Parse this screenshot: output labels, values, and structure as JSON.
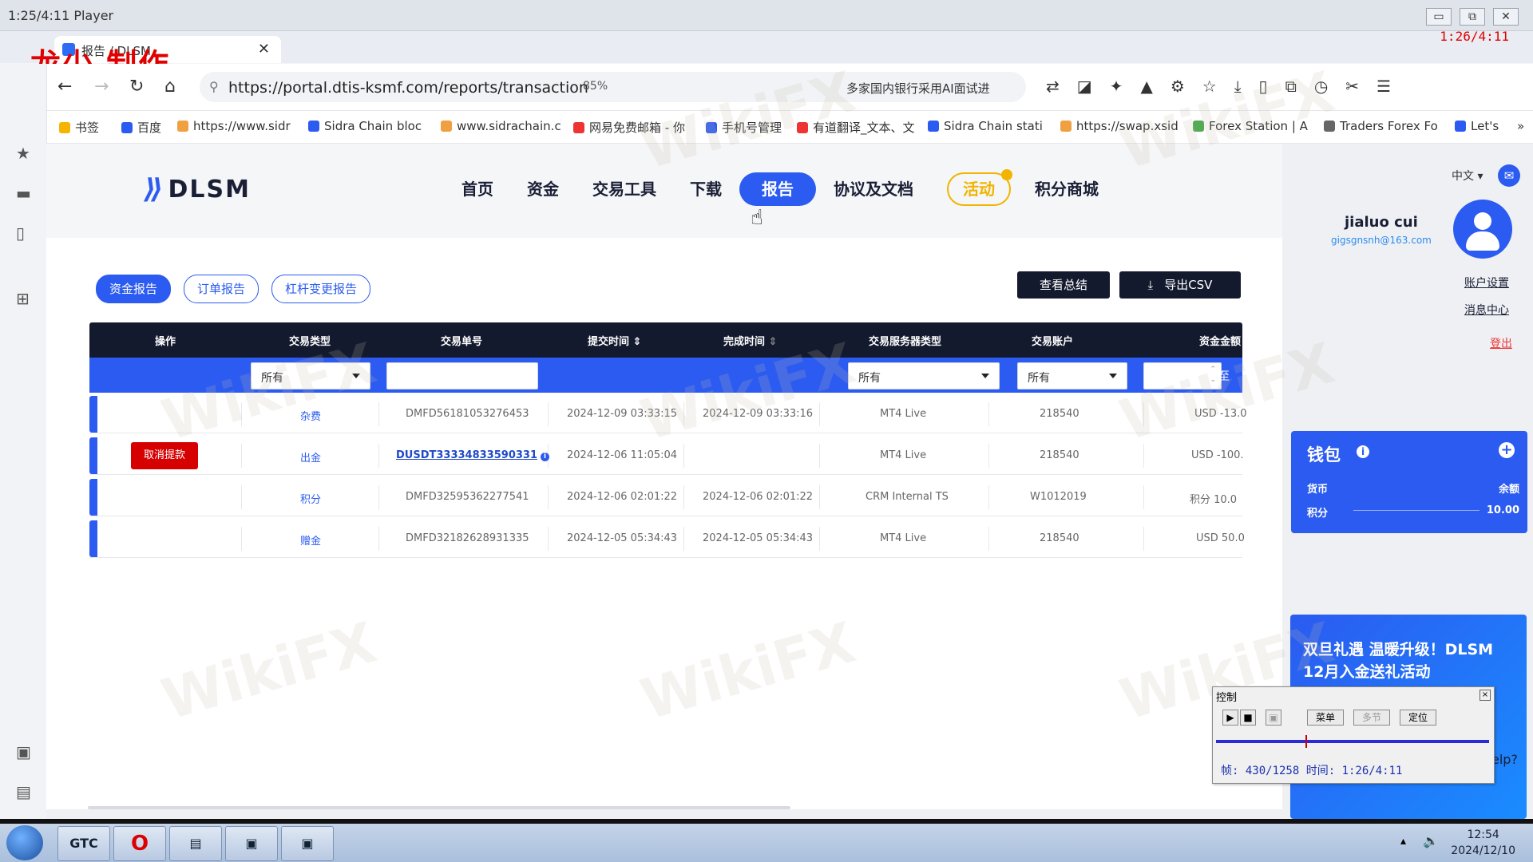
{
  "window": {
    "title": "1:25/4:11 Player",
    "controls": [
      "▭",
      "⧉",
      "✕"
    ]
  },
  "overlay": {
    "author_text": "龙少 制作",
    "timer": "1:26/4:11"
  },
  "tab": {
    "label": "报告 / DLSM",
    "close": "✕"
  },
  "address_bar": {
    "url": "https://portal.dtis-ksmf.com/reports/transaction",
    "zoom": "85%",
    "ai_text": "多家国内银行采用AI面试进"
  },
  "bookmarks": [
    {
      "label": "书签",
      "color": "#f5b400"
    },
    {
      "label": "百度",
      "color": "#2b5bf0"
    },
    {
      "label": "https://www.sidr",
      "color": "#f0a040"
    },
    {
      "label": "Sidra Chain bloc",
      "color": "#2b5bf0"
    },
    {
      "label": "www.sidrachain.c",
      "color": "#f0a040"
    },
    {
      "label": "网易免费邮箱 - 你",
      "color": "#e33"
    },
    {
      "label": "手机号管理",
      "color": "#2b5bf0"
    },
    {
      "label": "有道翻译_文本、文",
      "color": "#e33"
    },
    {
      "label": "Sidra Chain stati",
      "color": "#2b5bf0"
    },
    {
      "label": "https://swap.xsid",
      "color": "#f0a040"
    },
    {
      "label": "Forex Station | A",
      "color": "#5a5"
    },
    {
      "label": "Traders Forex Fo",
      "color": "#666"
    },
    {
      "label": "Let's",
      "color": "#2b5bf0"
    }
  ],
  "site": {
    "logo_mark": "⟫",
    "logo_word": "DLSM",
    "nav": [
      "首页",
      "资金",
      "交易工具",
      "下载",
      "报告",
      "协议及文档",
      "活动",
      "积分商城"
    ],
    "active_nav": "报告",
    "lang": "中文 ▾"
  },
  "report": {
    "subtabs": [
      "资金报告",
      "订单报告",
      "杠杆变更报告"
    ],
    "active_subtab": "资金报告",
    "view_summary": "查看总结",
    "export_csv": "导出CSV",
    "columns": [
      "操作",
      "交易类型",
      "交易单号",
      "提交时间",
      "完成时间",
      "交易服务器类型",
      "交易账户",
      "资金金额"
    ],
    "filters": {
      "type_value": "所有",
      "server_value": "所有",
      "account_value": "所有",
      "to_label": "至"
    },
    "rows": [
      {
        "action": "",
        "type": "杂费",
        "id": "DMFD56181053276453",
        "submit": "2024-12-09 03:33:15",
        "complete": "2024-12-09 03:33:16",
        "server": "MT4 Live",
        "account": "218540",
        "amount": "USD -13.0"
      },
      {
        "action": "取消提款",
        "type": "出金",
        "id": "DUSDT33334833590331",
        "submit": "2024-12-06 11:05:04",
        "complete": "",
        "server": "MT4 Live",
        "account": "218540",
        "amount": "USD -100."
      },
      {
        "action": "",
        "type": "积分",
        "id": "DMFD32595362277541",
        "submit": "2024-12-06 02:01:22",
        "complete": "2024-12-06 02:01:22",
        "server": "CRM Internal TS",
        "account": "W1012019",
        "amount": "积分 10.0"
      },
      {
        "action": "",
        "type": "赠金",
        "id": "DMFD32182628931335",
        "submit": "2024-12-05 05:34:43",
        "complete": "2024-12-05 05:34:43",
        "server": "MT4 Live",
        "account": "218540",
        "amount": "USD 50.0"
      }
    ]
  },
  "user": {
    "name": "jialuo cui",
    "email": "gigsgnsnh@163.com",
    "account_settings": "账户设置",
    "message_center": "消息中心",
    "logout": "登出"
  },
  "wallet": {
    "title": "钱包",
    "currency_label": "货币",
    "balance_label": "余额",
    "points_label": "积分",
    "points_value": "10.00"
  },
  "promo": {
    "text": "双旦礼遇 温暖升级！DLSM 12月入金送礼活动",
    "help": "elp?"
  },
  "control_window": {
    "title": "控制",
    "btn_menu": "菜单",
    "btn_multi": "多节",
    "btn_locate": "定位",
    "status": "帧: 430/1258 时间: 1:26/4:11"
  },
  "watermark": "WikiFX",
  "taskbar": {
    "items": [
      "GTC",
      "O",
      "▤",
      "▣",
      "▣"
    ],
    "time": "12:54",
    "date": "2024/12/10"
  }
}
